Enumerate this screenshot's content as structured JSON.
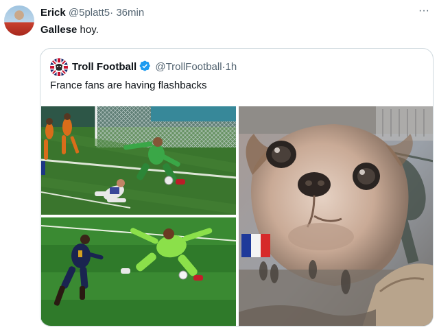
{
  "tweet": {
    "author_name": "Erick",
    "author_handle": "@5platt5",
    "separator": "·",
    "time": "36min",
    "more_label": "···",
    "text_bold": "Gallese",
    "text_rest": " hoy."
  },
  "quoted": {
    "author_name": "Troll Football",
    "author_handle": "@TrollFootball",
    "separator": "·",
    "time": "1h",
    "verified_icon": "verified-badge-icon",
    "text": "France fans are having flashbacks"
  },
  "media": {
    "images": [
      {
        "name": "goalkeeper-save-photo-top"
      },
      {
        "name": "goalkeeper-save-photo-bottom"
      },
      {
        "name": "dog-flashback-meme"
      }
    ]
  },
  "colors": {
    "verified_blue": "#1d9bf0",
    "border": "#cfd9de",
    "secondary_text": "#536471"
  }
}
